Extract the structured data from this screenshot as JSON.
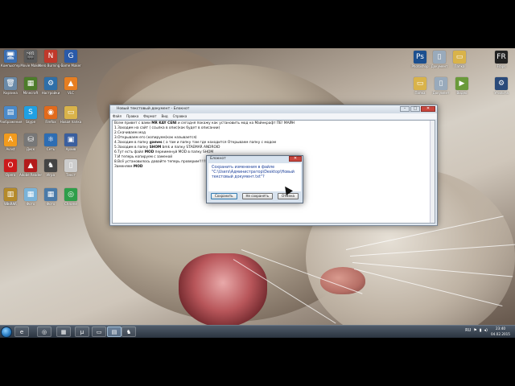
{
  "desktop_icons_left": [
    {
      "name": "computer-icon",
      "label": "Компьютер",
      "glyph": "🖥",
      "color": "#3b6fb3"
    },
    {
      "name": "movie-maker-icon",
      "label": "Movie Maker",
      "glyph": "🎬",
      "color": "#5c5c5c"
    },
    {
      "name": "nero-icon",
      "label": "Nero Burning ROM",
      "glyph": "N",
      "color": "#c0392b"
    },
    {
      "name": "gamemaker-icon",
      "label": "Game Maker",
      "glyph": "G",
      "color": "#2a5aa8"
    },
    {
      "name": "recycle-bin-icon",
      "label": "Корзина",
      "glyph": "🗑",
      "color": "#6a8aa8"
    },
    {
      "name": "minecraft-icon",
      "label": "Minecraft",
      "glyph": "▦",
      "color": "#4d7c2a"
    },
    {
      "name": "settings-app-icon",
      "label": "Настройки",
      "glyph": "⚙",
      "color": "#2e6fa8"
    },
    {
      "name": "vlc-icon",
      "label": "VLC",
      "glyph": "▲",
      "color": "#e67e22"
    },
    {
      "name": "images-icon",
      "label": "Изображения",
      "glyph": "▤",
      "color": "#4a8ac9"
    },
    {
      "name": "skype-icon",
      "label": "Skype",
      "glyph": "S",
      "color": "#1fa0e3"
    },
    {
      "name": "firefox-icon",
      "label": "Firefox",
      "glyph": "◉",
      "color": "#e26a1b"
    },
    {
      "name": "folder-icon",
      "label": "Новая папка",
      "glyph": "▭",
      "color": "#d9b34a"
    },
    {
      "name": "avast-icon",
      "label": "Avast",
      "glyph": "A",
      "color": "#f29b1d"
    },
    {
      "name": "drive-icon",
      "label": "Диск",
      "glyph": "⛁",
      "color": "#777"
    },
    {
      "name": "network-icon",
      "label": "Сеть",
      "glyph": "⚛",
      "color": "#2d6db3"
    },
    {
      "name": "archive-icon",
      "label": "Архив",
      "glyph": "▣",
      "color": "#3a5f9f"
    },
    {
      "name": "opera-icon",
      "label": "Opera",
      "glyph": "O",
      "color": "#cc1b1b"
    },
    {
      "name": "acrobat-icon",
      "label": "Adobe Reader",
      "glyph": "▲",
      "color": "#b31b1b"
    },
    {
      "name": "game-icon",
      "label": "Игра",
      "glyph": "♞",
      "color": "#444"
    },
    {
      "name": "textfile-icon",
      "label": "Текст",
      "glyph": "▯",
      "color": "#ccc"
    },
    {
      "name": "photo1-icon",
      "label": "Фото",
      "glyph": "▦",
      "color": "#5a8a3a"
    },
    {
      "name": "photo2-icon",
      "label": "Фото",
      "glyph": "▦",
      "color": "#7ab3d9"
    },
    {
      "name": "photo3-icon",
      "label": "Фото",
      "glyph": "▦",
      "color": "#4a7aa8"
    },
    {
      "name": "chrome-icon",
      "label": "Chrome",
      "glyph": "◎",
      "color": "#2e9e4a"
    },
    {
      "name": "winrar-icon",
      "label": "WinRAR",
      "glyph": "▥",
      "color": "#b58a2a"
    }
  ],
  "desktop_icons_right": [
    {
      "name": "photoshop-icon",
      "label": "Photoshop",
      "glyph": "Ps",
      "color": "#1b4f8f"
    },
    {
      "name": "doc1-icon",
      "label": "Документ",
      "glyph": "▯",
      "color": "#9ab"
    },
    {
      "name": "folder2-icon",
      "label": "Папка",
      "glyph": "▭",
      "color": "#d9b34a"
    },
    {
      "name": "fraps-icon",
      "label": "Fraps",
      "glyph": "FR",
      "color": "#222"
    },
    {
      "name": "folder3-icon",
      "label": "Папка",
      "glyph": "▭",
      "color": "#d9b34a"
    },
    {
      "name": "doc2-icon",
      "label": "Документ",
      "glyph": "▯",
      "color": "#9ab"
    },
    {
      "name": "video-icon",
      "label": "Видео",
      "glyph": "▶",
      "color": "#6a9a3a"
    },
    {
      "name": "tool-icon",
      "label": "Утилита",
      "glyph": "⚙",
      "color": "#2a4a7a"
    }
  ],
  "notepad": {
    "title": "Новый текстовый документ - Блокнот",
    "menu": [
      "Файл",
      "Правка",
      "Формат",
      "Вид",
      "Справка"
    ],
    "lines": [
      {
        "pre": "Всем привет с вами ",
        "bold": "MR KAY CENI",
        "post": " и сегодня покажу как установить мод на Майнкрафт ПЕ! МАЙН"
      },
      {
        "pre": "1.Заходим на сайт ( ссылка в опис(как будет в описании)",
        "bold": "",
        "post": ""
      },
      {
        "pre": "2.Скачиваем мод",
        "bold": "",
        "post": ""
      },
      {
        "pre": "3.Открываем его (копируем(как называется)",
        "bold": "",
        "post": ""
      },
      {
        "pre": "4.Заходим в папку ",
        "bold": "games",
        "post": " ( а там и папку там где находится             Открываем папку с модом"
      },
      {
        "pre": "5.Заходим в папку ",
        "bold": "SHOM",
        "post": " bmk и папку STAEMAR ANDROID"
      },
      {
        "pre": "6.Тут есть файл ",
        "bold": "MOD",
        "post": " переименуй MOD в папку SHOM"
      },
      {
        "pre": "7.И теперь копируем с заменой",
        "bold": "",
        "post": ""
      },
      {
        "pre": "8.Всё установилось давайте теперь проверим!!!!!!!!!!!!!",
        "bold": "",
        "post": ""
      },
      {
        "pre": "Заменяем ",
        "bold": "MOD",
        "post": ""
      }
    ]
  },
  "dialog": {
    "title": "Блокнот",
    "message": "Сохранить изменения в файле \"C:\\Users\\Администратор\\Desktop\\Новый текстовый документ.txt\"?",
    "buttons": {
      "save": "Сохранить",
      "dont_save": "Не сохранять",
      "cancel": "Отмена"
    }
  },
  "taskbar": {
    "apps": [
      {
        "name": "ie-taskbar-icon",
        "glyph": "e"
      },
      {
        "name": "chrome-taskbar-icon",
        "glyph": "◎"
      },
      {
        "name": "photos-taskbar-icon",
        "glyph": "▦"
      },
      {
        "name": "utorrent-taskbar-icon",
        "glyph": "µ"
      },
      {
        "name": "explorer-taskbar-icon",
        "glyph": "▭"
      },
      {
        "name": "notepad-taskbar-icon",
        "glyph": "▤"
      },
      {
        "name": "game-taskbar-icon",
        "glyph": "♞"
      }
    ],
    "language": "RU",
    "clock_time": "23:40",
    "clock_date": "04.02.2015"
  }
}
